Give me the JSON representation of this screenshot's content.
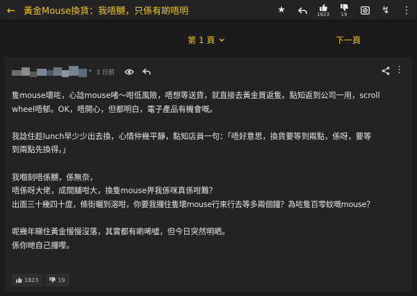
{
  "topbar": {
    "title": "黃金Mouse換貨：我唔嬲，只係有啲唔明",
    "like_count": "1823",
    "dislike_count": "19"
  },
  "pager": {
    "current_page": "第 1 頁",
    "next_page": "下一頁"
  },
  "post": {
    "time": "3 日前",
    "paragraphs": [
      [
        "隻mouse壞咗，心諗mouse啫～咁低風險，唔想等送貨，就直接去黃金買返隻。點知返到公司一用，scroll",
        "wheel唔郁。OK，唔開心，但都明白，電子產品有機會嘅。"
      ],
      [
        "我諗住趁lunch早少少出去換，心情仲幾平靜，點知店員一句：「唔好意思，換貨要等到兩點，係呀，要等",
        "到兩點先換得。」"
      ],
      [
        "我嗰刻唔係嬲，係無奈，",
        "唔係呀大佬，成間舖咁大，換隻mouse畀我係咪真係咁難？",
        "出面三十幾四十度，條街曬到溶咁，你要我攞住隻壞mouse行來行去等多兩個鐘？為咗隻百零蚊嘅mouse？"
      ],
      [
        "呢幾年睇住黃金慢慢沒落，其實都有啲唏噓，但今日突然明晒。",
        "係你哋自己攞嚟。"
      ]
    ],
    "likes": "1823",
    "dislikes": "19"
  },
  "icons": {
    "back": "arrow-left-icon",
    "star": "star-icon",
    "reply": "reply-icon",
    "like": "thumbs-up-icon",
    "dislike": "thumbs-down-icon",
    "block": "block-icon",
    "flash": "lightning-icon",
    "more": "more-vertical-icon",
    "eye": "eye-icon",
    "share": "share-icon"
  },
  "colors": {
    "accent": "#f0c419",
    "background": "#1b1b1b",
    "card": "#232323"
  }
}
